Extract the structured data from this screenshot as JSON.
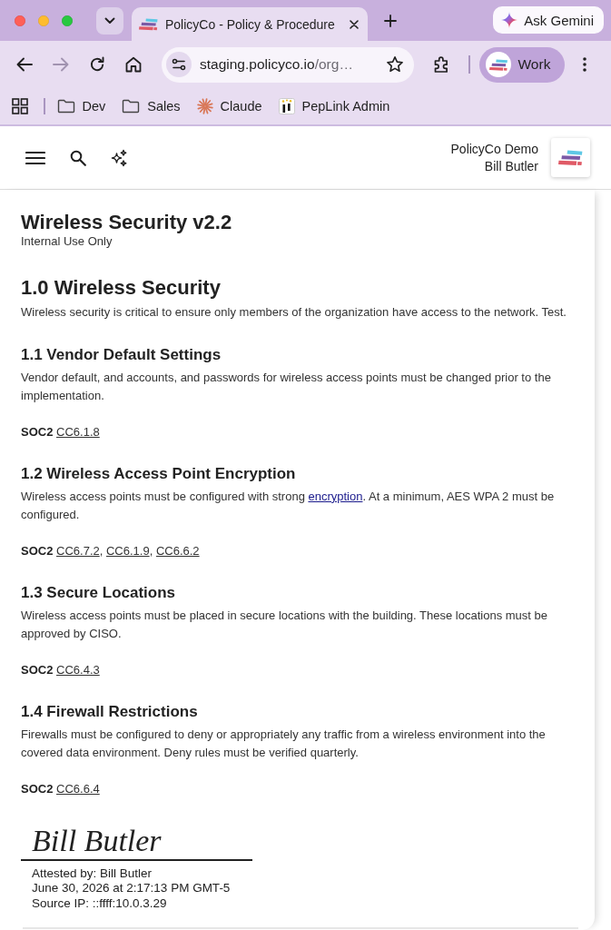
{
  "browser": {
    "tabs": [
      {
        "title": "PolicyCo - Policy & Procedure",
        "selected": true
      }
    ],
    "assistant_button": "Ask Gemini",
    "nav_buttons": [
      {
        "kind": "back",
        "disabled": false
      },
      {
        "kind": "forward",
        "disabled": true
      },
      {
        "kind": "reload",
        "disabled": false
      },
      {
        "kind": "home",
        "disabled": false
      }
    ],
    "address": {
      "host": "staging.policyco.io",
      "path": "/org…"
    },
    "profile": "Work",
    "bookmarks": [
      {
        "label": "Dev",
        "kind": "folder"
      },
      {
        "label": "Sales",
        "kind": "folder"
      },
      {
        "label": "Claude",
        "kind": "starburst"
      },
      {
        "label": "PepLink Admin",
        "kind": "tile"
      }
    ]
  },
  "app_header": {
    "org_name": "PolicyCo Demo",
    "user_name": "Bill Butler"
  },
  "document": {
    "title": "Wireless Security v2.2",
    "classification": "Internal Use Only",
    "sections": [
      {
        "kind": "chapter",
        "heading": "1.0 Wireless Security",
        "body": [
          {
            "kind": "text",
            "text": "Wireless security is critical to ensure only members of the organization have access to the network. Test."
          }
        ]
      },
      {
        "kind": "subsection",
        "heading": "1.1 Vendor Default Settings",
        "body": [
          {
            "kind": "text",
            "text": "Vendor default, and accounts, and passwords for wireless access points must be changed prior to the implementation."
          }
        ],
        "reference": {
          "framework": "SOC2",
          "parts": [
            {
              "kind": "link",
              "text": "CC6.1.8"
            }
          ]
        }
      },
      {
        "kind": "subsection",
        "heading": "1.2 Wireless Access Point Encryption",
        "body": [
          {
            "kind": "text",
            "text": "Wireless access points must be configured with strong "
          },
          {
            "kind": "link",
            "text": "encryption"
          },
          {
            "kind": "text",
            "text": ". At a minimum, AES WPA 2 must be configured."
          }
        ],
        "reference": {
          "framework": "SOC2",
          "parts": [
            {
              "kind": "link",
              "text": "CC6.7.2"
            },
            {
              "kind": "text",
              "text": ", "
            },
            {
              "kind": "link",
              "text": "CC6.1.9"
            },
            {
              "kind": "text",
              "text": ", "
            },
            {
              "kind": "link",
              "text": "CC6.6.2"
            }
          ]
        }
      },
      {
        "kind": "subsection",
        "heading": "1.3 Secure Locations",
        "body": [
          {
            "kind": "text",
            "text": "Wireless access points must be placed in secure locations with the building. These locations must be approved by CISO."
          }
        ],
        "reference": {
          "framework": "SOC2",
          "parts": [
            {
              "kind": "link",
              "text": "CC6.4.3"
            }
          ]
        }
      },
      {
        "kind": "subsection",
        "heading": "1.4 Firewall Restrictions",
        "body": [
          {
            "kind": "text",
            "text": "Firewalls must be configured to deny or appropriately any traffic from a wireless environment into the covered data environment. Deny rules must be verified quarterly."
          }
        ],
        "reference": {
          "framework": "SOC2",
          "parts": [
            {
              "kind": "link",
              "text": "CC6.6.4"
            }
          ]
        }
      }
    ]
  },
  "attestation": {
    "signature": "Bill Butler",
    "attested_by": "Attested by: Bill Butler",
    "timestamp": "June 30, 2026 at 2:17:13 PM GMT-5",
    "source_ip": "Source IP: ::ffff:10.0.3.29"
  }
}
